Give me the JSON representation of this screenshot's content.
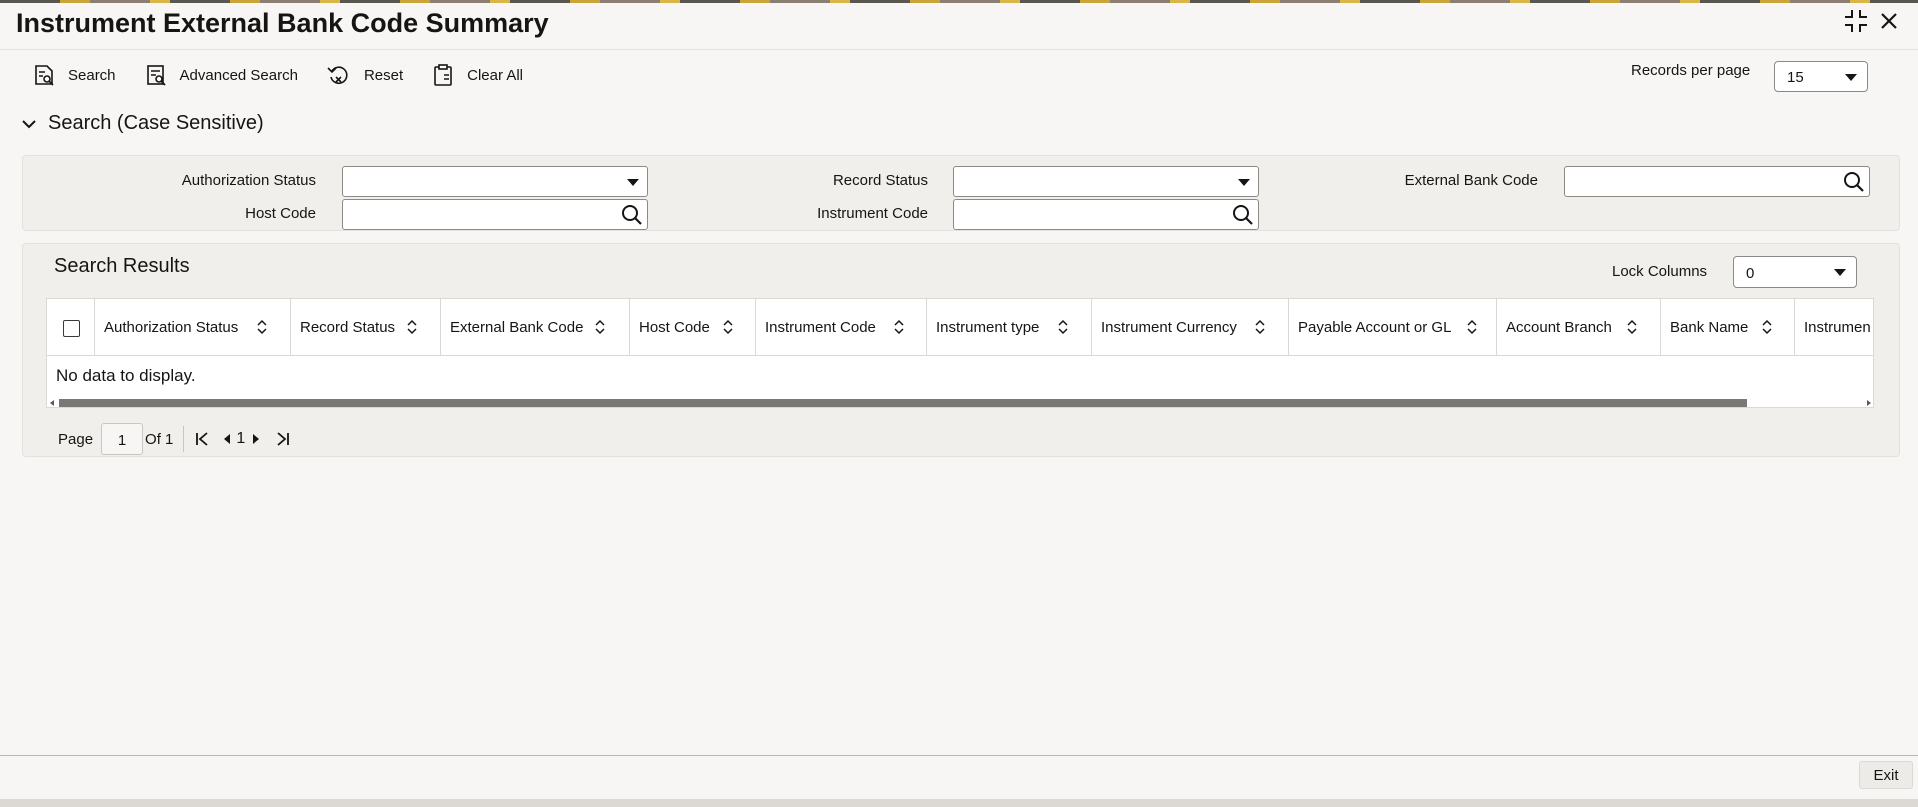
{
  "window": {
    "title": "Instrument External Bank Code Summary"
  },
  "toolbar": {
    "search_label": "Search",
    "advanced_search_label": "Advanced Search",
    "reset_label": "Reset",
    "clear_all_label": "Clear All",
    "records_per_page_label": "Records per page",
    "records_per_page_value": "15"
  },
  "search_section": {
    "title": "Search (Case Sensitive)",
    "fields": {
      "authorization_status_label": "Authorization Status",
      "authorization_status_value": "",
      "record_status_label": "Record Status",
      "record_status_value": "",
      "external_bank_code_label": "External Bank Code",
      "external_bank_code_value": "",
      "host_code_label": "Host Code",
      "host_code_value": "",
      "instrument_code_label": "Instrument Code",
      "instrument_code_value": ""
    }
  },
  "results": {
    "title": "Search Results",
    "lock_columns_label": "Lock Columns",
    "lock_columns_value": "0",
    "columns": [
      "Authorization Status",
      "Record Status",
      "External Bank Code",
      "Host Code",
      "Instrument Code",
      "Instrument type",
      "Instrument Currency",
      "Payable Account or GL",
      "Account Branch",
      "Bank Name",
      "Instrumen"
    ],
    "empty_message": "No data to display."
  },
  "pagination": {
    "page_label": "Page",
    "current_page": "1",
    "of_label": "Of 1",
    "page_number": "1"
  },
  "footer": {
    "exit_label": "Exit"
  }
}
